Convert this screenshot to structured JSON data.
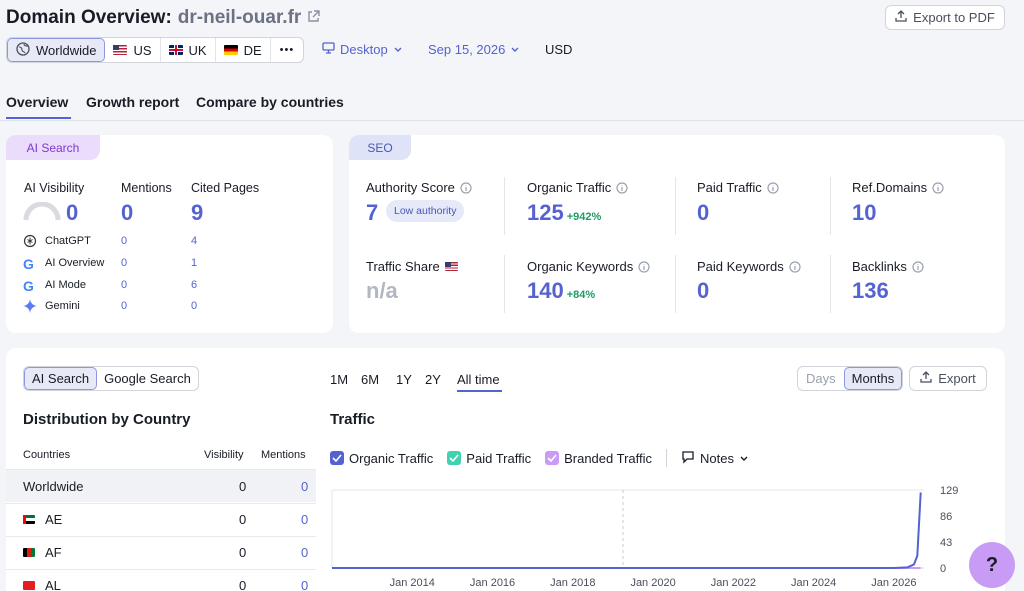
{
  "header": {
    "title_prefix": "Domain Overview:",
    "domain": "dr-neil-ouar.fr",
    "export_pdf": "Export to PDF",
    "regions": [
      {
        "label": "Worldwide",
        "active": true
      },
      {
        "label": "US"
      },
      {
        "label": "UK"
      },
      {
        "label": "DE"
      }
    ],
    "more": "•••",
    "device": "Desktop",
    "date": "Sep 15, 2026",
    "currency": "USD"
  },
  "tabs": [
    "Overview",
    "Growth report",
    "Compare by countries"
  ],
  "ai_search": {
    "badge": "AI Search",
    "cols": [
      "AI Visibility",
      "Mentions",
      "Cited Pages"
    ],
    "totals": [
      "0",
      "0",
      "9"
    ],
    "rows": [
      {
        "name": "ChatGPT",
        "icon": "chatgpt-icon",
        "mentions": "0",
        "cited": "4"
      },
      {
        "name": "AI Overview",
        "icon": "google-icon",
        "mentions": "0",
        "cited": "1"
      },
      {
        "name": "AI Mode",
        "icon": "google-icon",
        "mentions": "0",
        "cited": "6"
      },
      {
        "name": "Gemini",
        "icon": "gemini-icon",
        "mentions": "0",
        "cited": "0"
      }
    ]
  },
  "seo": {
    "badge": "SEO",
    "authority_label": "Authority Score",
    "authority_value": "7",
    "authority_badge": "Low authority",
    "organic_traffic_label": "Organic Traffic",
    "organic_traffic_value": "125",
    "organic_traffic_delta": "+942%",
    "paid_traffic_label": "Paid Traffic",
    "paid_traffic_value": "0",
    "ref_domains_label": "Ref.Domains",
    "ref_domains_value": "10",
    "traffic_share_label": "Traffic Share",
    "traffic_share_value": "n/a",
    "organic_keywords_label": "Organic Keywords",
    "organic_keywords_value": "140",
    "organic_keywords_delta": "+84%",
    "paid_keywords_label": "Paid Keywords",
    "paid_keywords_value": "0",
    "backlinks_label": "Backlinks",
    "backlinks_value": "136"
  },
  "bottom": {
    "toggle": [
      "AI Search",
      "Google Search"
    ],
    "ranges": [
      "1M",
      "6M",
      "1Y",
      "2Y",
      "All time"
    ],
    "granularity": [
      "Days",
      "Months"
    ],
    "export": "Export",
    "dist_title": "Distribution by Country",
    "dist_headers": [
      "Countries",
      "Visibility",
      "Mentions"
    ],
    "dist_rows": [
      {
        "country": "Worldwide",
        "visibility": "0",
        "mentions": "0"
      },
      {
        "country": "AE",
        "visibility": "0",
        "mentions": "0"
      },
      {
        "country": "AF",
        "visibility": "0",
        "mentions": "0"
      },
      {
        "country": "AL",
        "visibility": "0",
        "mentions": "0"
      }
    ],
    "traffic_title": "Traffic",
    "legend": [
      "Organic Traffic",
      "Paid Traffic",
      "Branded Traffic"
    ],
    "notes": "Notes"
  },
  "colors": {
    "organic": "#5562d1",
    "paid": "#3fd1b0",
    "branded": "#c89cf5",
    "accent": "#5562d1"
  },
  "chart_data": {
    "type": "line",
    "x_ticks": [
      "Jan 2014",
      "Jan 2016",
      "Jan 2018",
      "Jan 2020",
      "Jan 2022",
      "Jan 2024",
      "Jan 2026"
    ],
    "y_ticks": [
      "129",
      "86",
      "43",
      "0"
    ],
    "ylim": [
      0,
      129
    ],
    "series": [
      {
        "name": "Organic Traffic",
        "x": [
          "Jan 2012",
          "Jan 2014",
          "Jan 2016",
          "Jan 2018",
          "Jan 2020",
          "Jan 2022",
          "Jan 2024",
          "Jan 2026",
          "May 2026",
          "Jul 2026",
          "Aug 2026",
          "Sep 2026"
        ],
        "values": [
          0,
          0,
          0,
          0,
          0,
          0,
          0,
          0,
          1,
          6,
          20,
          125
        ]
      },
      {
        "name": "Branded Traffic",
        "x": [
          "Jan 2012",
          "Sep 2026"
        ],
        "values": [
          0,
          0
        ]
      }
    ]
  },
  "help": "?"
}
